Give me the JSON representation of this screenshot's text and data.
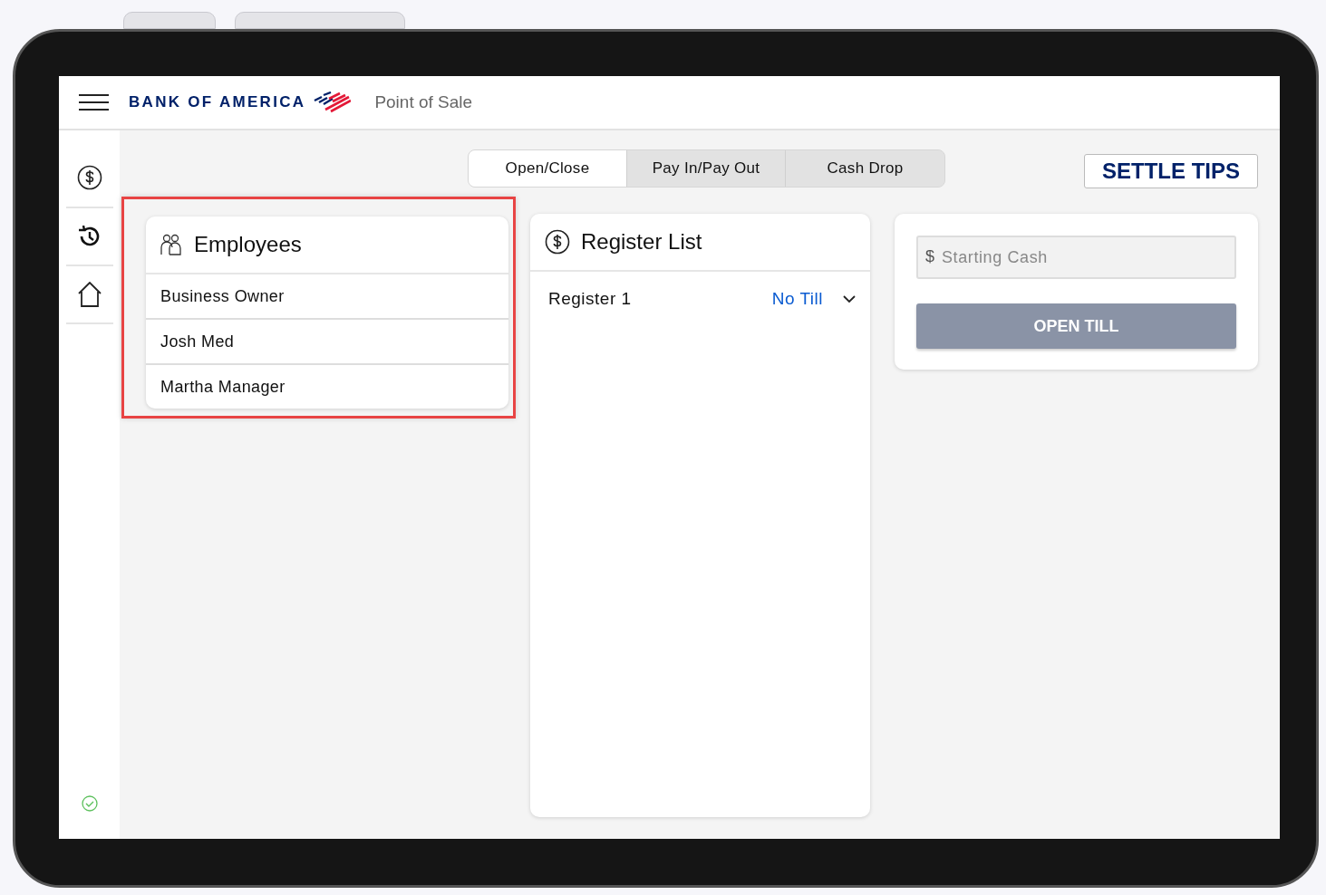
{
  "header": {
    "logo_text": "BANK OF AMERICA",
    "title": "Point of Sale"
  },
  "tabs": [
    {
      "label": "Open/Close",
      "selected": true
    },
    {
      "label": "Pay In/Pay Out",
      "selected": false
    },
    {
      "label": "Cash Drop",
      "selected": false
    }
  ],
  "settle_button": "SETTLE TIPS",
  "employees": {
    "title": "Employees",
    "highlighted": true,
    "items": [
      {
        "name": "Business Owner"
      },
      {
        "name": "Josh Med"
      },
      {
        "name": "Martha Manager"
      }
    ]
  },
  "register_list": {
    "title": "Register List",
    "rows": [
      {
        "name": "Register 1",
        "status": "No Till"
      }
    ]
  },
  "till": {
    "prefix": "$",
    "placeholder": "Starting Cash",
    "button": {
      "label": "OPEN TILL",
      "disabled": true
    }
  }
}
